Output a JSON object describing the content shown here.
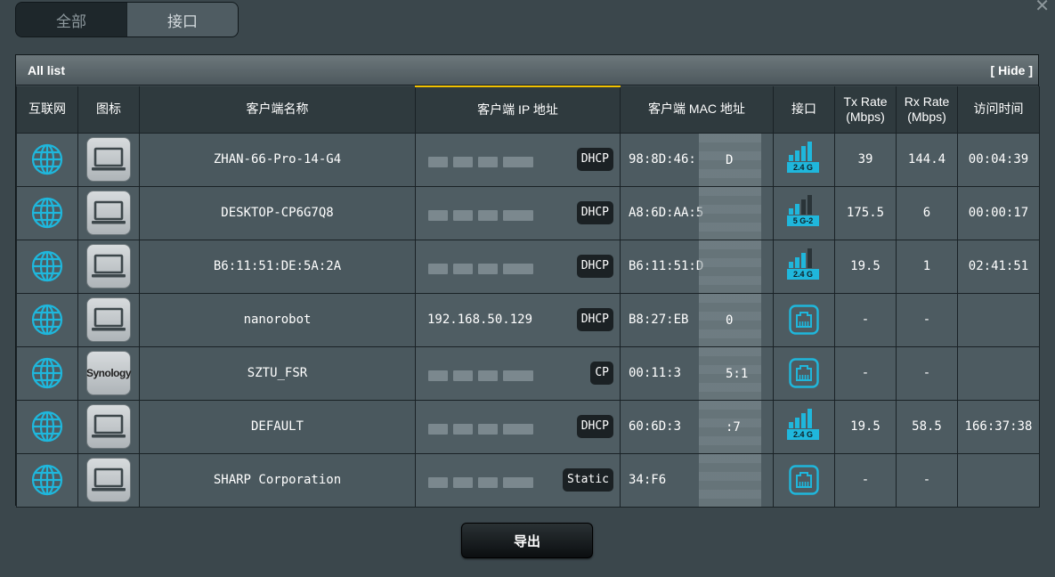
{
  "tabs": {
    "all": "全部",
    "interface": "接口"
  },
  "panel": {
    "title": "All list",
    "hide_label": "[ Hide ]"
  },
  "columns": {
    "internet": "互联网",
    "icon": "图标",
    "client_name": "客户端名称",
    "client_ip": "客户端 IP 地址",
    "client_mac": "客户端 MAC 地址",
    "interface": "接口",
    "tx_rate": "Tx Rate",
    "tx_unit": "(Mbps)",
    "rx_rate": "Rx Rate",
    "rx_unit": "(Mbps)",
    "access_time": "访问时间"
  },
  "rows": [
    {
      "name": "ZHAN-66-Pro-14-G4",
      "ip": "",
      "ip_type": "DHCP",
      "mac": "98:8D:46:",
      "mac_tail": "D",
      "iface": "wifi",
      "band": "2.4 G",
      "signal": 4,
      "tx": "39",
      "rx": "144.4",
      "time": "00:04:39",
      "device": "laptop"
    },
    {
      "name": "DESKTOP-CP6G7Q8",
      "ip": "",
      "ip_type": "DHCP",
      "mac": "A8:6D:AA:5",
      "mac_tail": "",
      "iface": "wifi",
      "band": "5 G-2",
      "signal": 2,
      "tx": "175.5",
      "rx": "6",
      "time": "00:00:17",
      "device": "laptop"
    },
    {
      "name": "B6:11:51:DE:5A:2A",
      "ip": "",
      "ip_type": "DHCP",
      "mac": "B6:11:51:D",
      "mac_tail": "",
      "iface": "wifi",
      "band": "2.4 G",
      "signal": 3,
      "tx": "19.5",
      "rx": "1",
      "time": "02:41:51",
      "device": "laptop"
    },
    {
      "name": "nanorobot",
      "ip": "192.168.50.129",
      "ip_type": "DHCP",
      "mac": "B8:27:EB",
      "mac_tail": "0",
      "iface": "ethernet",
      "band": "",
      "signal": 0,
      "tx": "-",
      "rx": "-",
      "time": "",
      "device": "laptop"
    },
    {
      "name": "SZTU_FSR",
      "ip": "",
      "ip_type": "CP",
      "mac": "00:11:3",
      "mac_tail": "5:1",
      "iface": "ethernet",
      "band": "",
      "signal": 0,
      "tx": "-",
      "rx": "-",
      "time": "",
      "device": "synology"
    },
    {
      "name": "DEFAULT",
      "ip": "",
      "ip_type": "DHCP",
      "mac": "60:6D:3",
      "mac_tail": ":7",
      "iface": "wifi",
      "band": "2.4 G",
      "signal": 4,
      "tx": "19.5",
      "rx": "58.5",
      "time": "166:37:38",
      "device": "laptop"
    },
    {
      "name": "SHARP Corporation",
      "ip": "",
      "ip_type": "Static",
      "mac": "34:F6",
      "mac_tail": "",
      "iface": "ethernet",
      "band": "",
      "signal": 0,
      "tx": "-",
      "rx": "-",
      "time": "",
      "device": "laptop"
    }
  ],
  "device_labels": {
    "synology": "Synology"
  },
  "export_label": "导出",
  "icons": {
    "globe": "globe-icon",
    "laptop": "laptop-icon",
    "ethernet": "ethernet-port-icon",
    "wifi": "wifi-signal-icon",
    "close": "close-icon"
  },
  "colors": {
    "accent": "#1fb7dc",
    "sort_indicator": "#f2c100"
  }
}
